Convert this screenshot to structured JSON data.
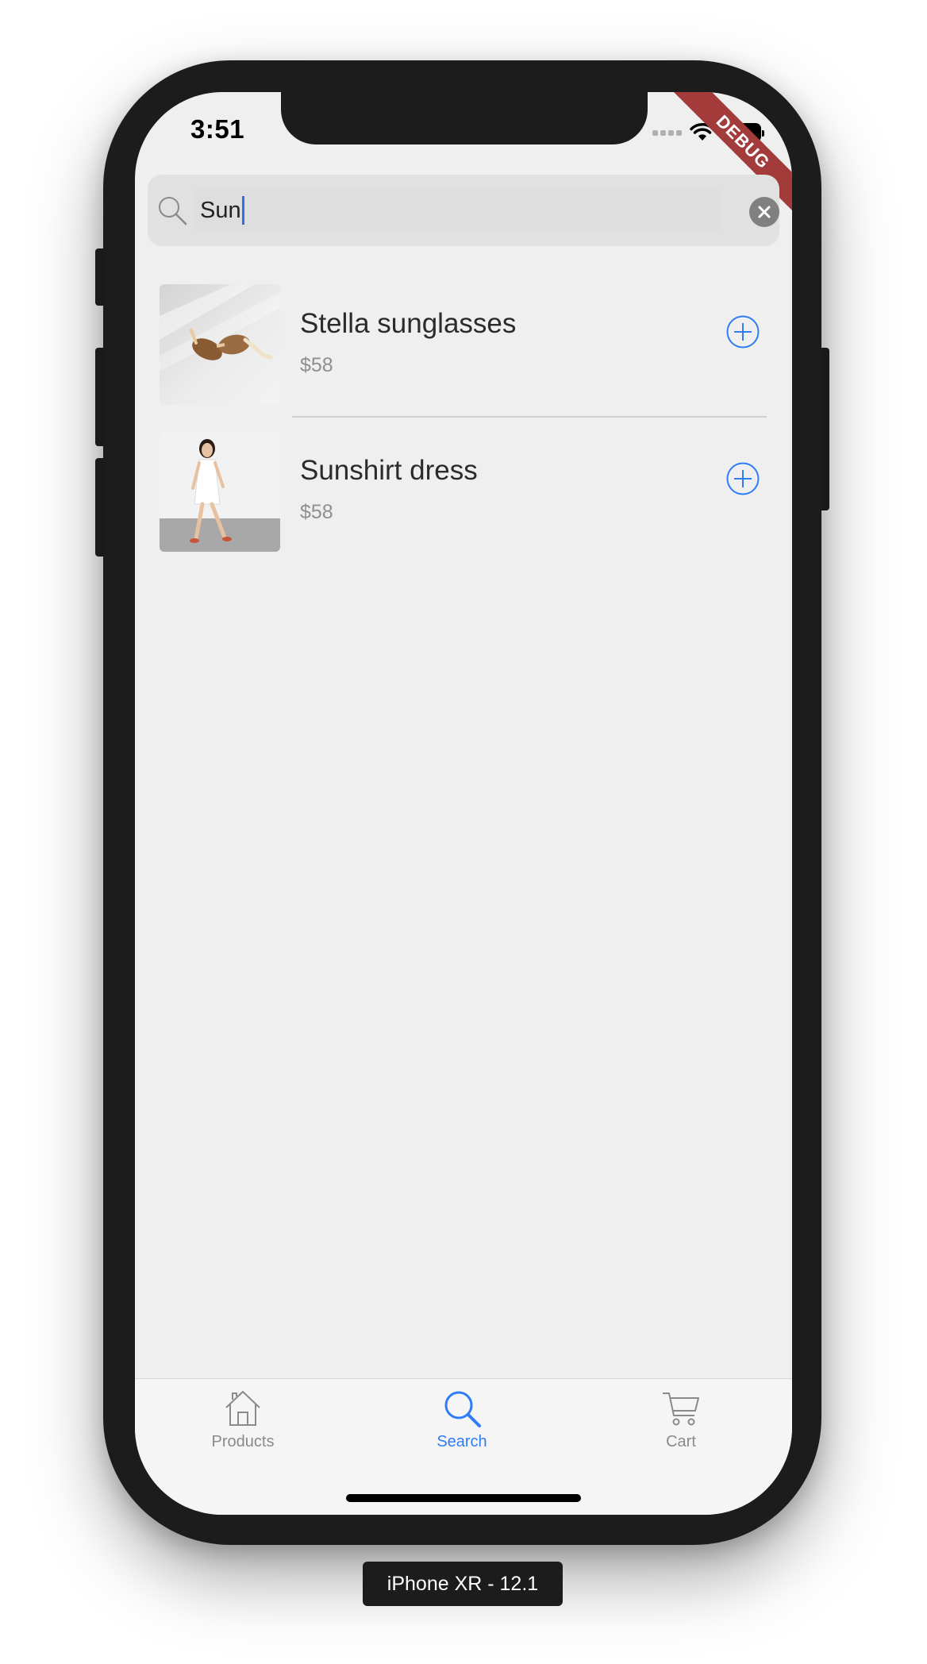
{
  "status_bar": {
    "time": "3:51"
  },
  "debug_banner": "DEBUG",
  "search": {
    "query": "Sun"
  },
  "results": [
    {
      "name": "Stella sunglasses",
      "price": "$58"
    },
    {
      "name": "Sunshirt dress",
      "price": "$58"
    }
  ],
  "tabs": [
    {
      "label": "Products",
      "icon": "home-icon",
      "active": false
    },
    {
      "label": "Search",
      "icon": "search-icon",
      "active": true
    },
    {
      "label": "Cart",
      "icon": "cart-icon",
      "active": false
    }
  ],
  "device_label": "iPhone XR - 12.1",
  "colors": {
    "accent": "#2f7cf6",
    "inactive": "#8a8a8a",
    "background": "#efefef",
    "debug": "#a33b3b"
  }
}
